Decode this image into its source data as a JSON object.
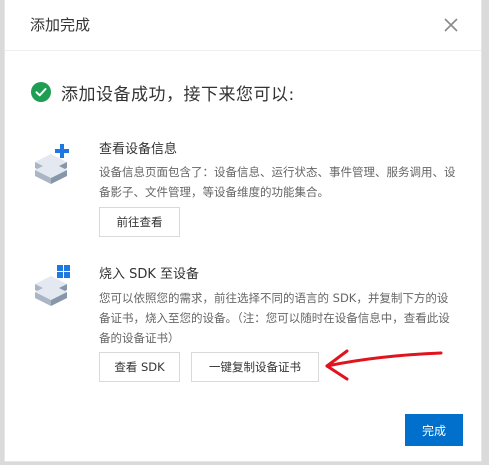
{
  "dialog": {
    "title": "添加完成",
    "close_icon": "close-icon"
  },
  "success": {
    "icon": "check-circle-icon",
    "color": "#1e9e52",
    "message": "添加设备成功，接下来您可以:"
  },
  "cards": [
    {
      "icon": "device-add-icon",
      "title": "查看设备信息",
      "description": "设备信息页面包含了：设备信息、运行状态、事件管理、服务调用、设备影子、文件管理，等设备维度的功能集合。",
      "buttons": [
        "前往查看"
      ]
    },
    {
      "icon": "device-sdk-icon",
      "title": "烧入 SDK 至设备",
      "description": "您可以依照您的需求，前往选择不同的语言的 SDK，并复制下方的设备证书，烧入至您的设备。（注：您可以随时在设备信息中，查看此设备的设备证书）",
      "buttons": [
        "查看 SDK",
        "一键复制设备证书"
      ]
    }
  ],
  "footer": {
    "done_label": "完成",
    "accent": "#0070cc"
  },
  "annotation": {
    "arrow_color": "#e0141e"
  }
}
